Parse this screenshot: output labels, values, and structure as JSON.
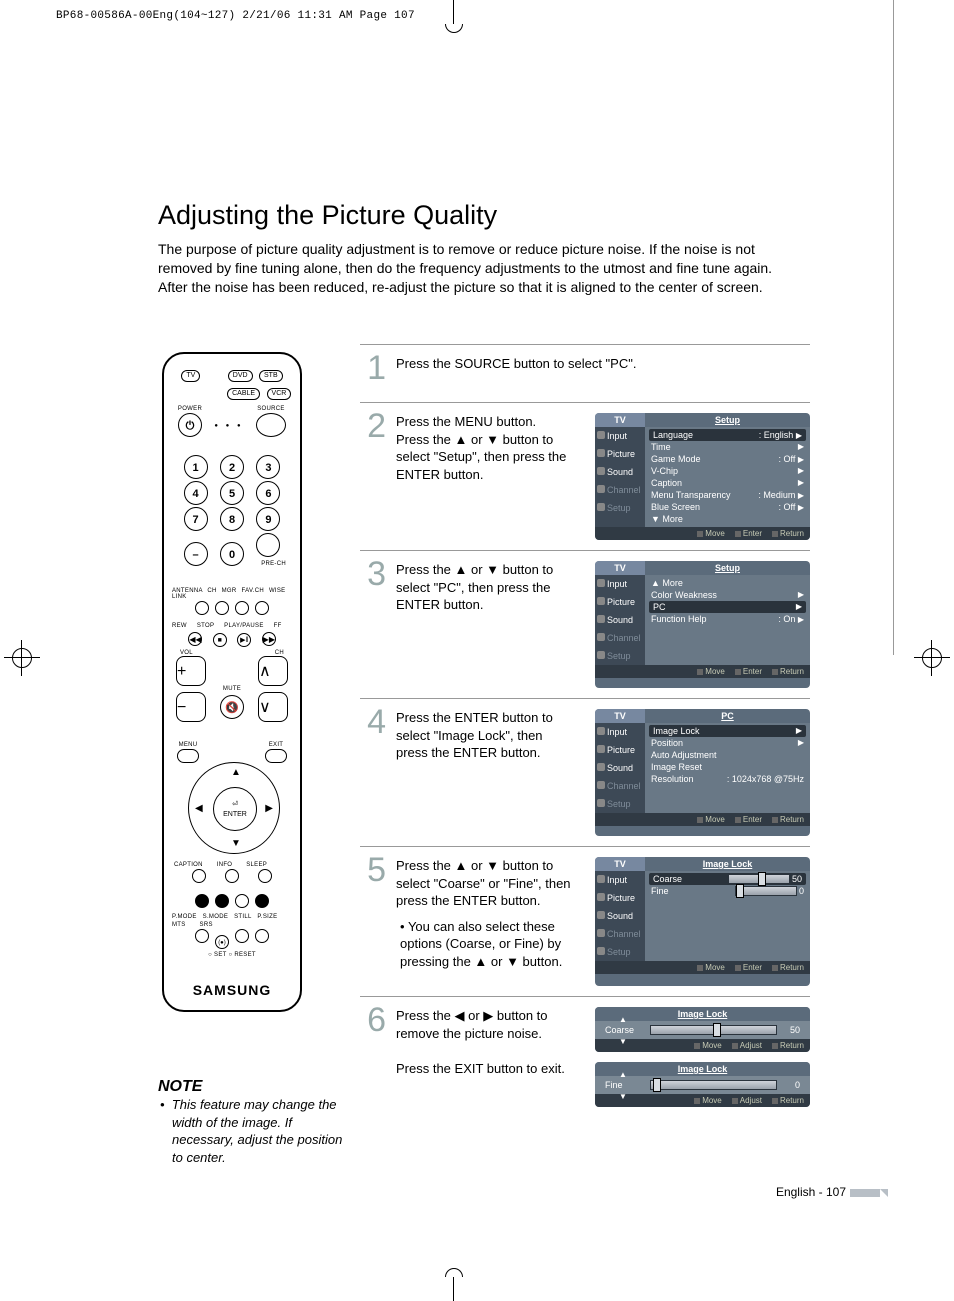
{
  "crop_header": "BP68-00586A-00Eng(104~127)  2/21/06  11:31 AM  Page 107",
  "page_title": "Adjusting the Picture Quality",
  "intro": "The purpose of picture quality adjustment is to remove or reduce picture noise. If the noise is not removed by fine tuning alone, then do the frequency adjustments to the utmost and fine tune again. After the noise has been reduced, re-adjust the picture so that it is aligned to the center of screen.",
  "note": {
    "title": "NOTE",
    "text": "This feature may change the width of the image. If necessary, adjust the position to center."
  },
  "footer": "English - 107",
  "steps": {
    "s1": {
      "num": "1",
      "text": "Press the SOURCE button to select \"PC\"."
    },
    "s2": {
      "num": "2",
      "text": "Press the MENU button. Press the ▲ or ▼ button to select \"Setup\", then press the ENTER button."
    },
    "s3": {
      "num": "3",
      "text": "Press the ▲ or ▼ button to select \"PC\", then press the ENTER button."
    },
    "s4": {
      "num": "4",
      "text": "Press the ENTER button to select \"Image Lock\", then press the ENTER button."
    },
    "s5": {
      "num": "5",
      "text": "Press the ▲ or ▼ button to select \"Coarse\" or \"Fine\", then press the ENTER button.",
      "bullet": "You can also select these options (Coarse, or Fine) by pressing the ▲ or ▼ button."
    },
    "s6": {
      "num": "6",
      "text": "Press the ◀ or ▶ button to remove the picture noise.",
      "text2": "Press the EXIT button to exit."
    }
  },
  "osd": {
    "tv": "TV",
    "side": {
      "input": "Input",
      "picture": "Picture",
      "sound": "Sound",
      "channel": "Channel",
      "setup": "Setup"
    },
    "foot": {
      "move": "Move",
      "enter": "Enter",
      "return": "Return",
      "adjust": "Adjust"
    },
    "p2": {
      "title": "Setup",
      "rows": [
        {
          "l": "Language",
          "v": ": English"
        },
        {
          "l": "Time",
          "v": ""
        },
        {
          "l": "Game Mode",
          "v": ": Off"
        },
        {
          "l": "V-Chip",
          "v": ""
        },
        {
          "l": "Caption",
          "v": ""
        },
        {
          "l": "Menu Transparency",
          "v": ": Medium"
        },
        {
          "l": "Blue Screen",
          "v": ": Off"
        },
        {
          "l": "▼ More",
          "v": ""
        }
      ]
    },
    "p3": {
      "title": "Setup",
      "rows": [
        {
          "l": "▲ More",
          "v": ""
        },
        {
          "l": "Color Weakness",
          "v": ""
        },
        {
          "l": "PC",
          "v": ""
        },
        {
          "l": "Function Help",
          "v": ": On"
        }
      ]
    },
    "p4": {
      "title": "PC",
      "rows": [
        {
          "l": "Image Lock",
          "v": ""
        },
        {
          "l": "Position",
          "v": ""
        },
        {
          "l": "Auto Adjustment",
          "v": ""
        },
        {
          "l": "Image Reset",
          "v": ""
        },
        {
          "l": "Resolution",
          "v": ": 1024x768 @75Hz"
        }
      ]
    },
    "p5": {
      "title": "Image Lock",
      "rows": [
        {
          "l": "Coarse",
          "v": "50"
        },
        {
          "l": "Fine",
          "v": "0"
        }
      ]
    },
    "p6a": {
      "title": "Image Lock",
      "label": "Coarse",
      "value": "50",
      "pct": 50
    },
    "p6b": {
      "title": "Image Lock",
      "label": "Fine",
      "value": "0",
      "pct": 2
    }
  },
  "remote": {
    "mode": {
      "tv": "TV",
      "dvd": "DVD",
      "stb": "STB",
      "cable": "CABLE",
      "vcr": "VCR"
    },
    "power": "POWER",
    "source": "SOURCE",
    "nums": [
      "1",
      "2",
      "3",
      "4",
      "5",
      "6",
      "7",
      "8",
      "9",
      "0"
    ],
    "dash": "–",
    "prech": "PRE-CH",
    "row_labels": "ANTENNA  CH MGR   FAV.CH   WISE LINK",
    "transport": {
      "rew": "REW",
      "stop": "STOP",
      "play": "PLAY/PAUSE",
      "ff": "FF"
    },
    "vol": "VOL",
    "ch": "CH",
    "mute": "MUTE",
    "menu": "MENU",
    "exit": "EXIT",
    "enter": "ENTER",
    "row2": "CAPTION        INFO        SLEEP",
    "row3": "P.MODE   S.MODE    STILL    P.SIZE",
    "row4": "MTS        SRS",
    "setreset": "○ SET     ○ RESET",
    "brand": "SAMSUNG"
  }
}
